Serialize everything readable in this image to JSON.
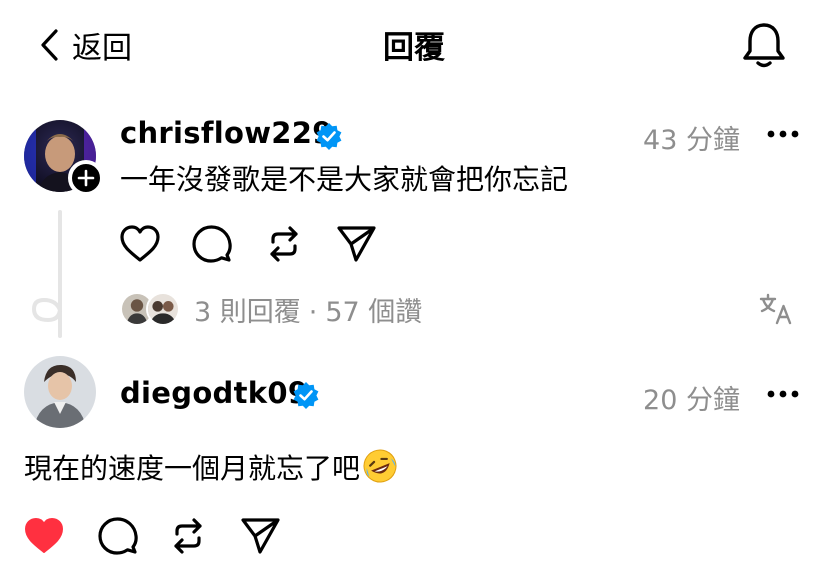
{
  "header": {
    "back_label": "返回",
    "title": "回覆"
  },
  "comments": [
    {
      "username": "chrisflow229",
      "verified": true,
      "time": "43 分鐘",
      "text": "一年沒發歌是不是大家就會把你忘記",
      "replies": "3 則回覆",
      "likes": "57 個讚"
    },
    {
      "username": "diegodtk09",
      "verified": true,
      "time": "20 分鐘",
      "text": "現在的速度一個月就忘了吧",
      "emoji": "rolling-on-floor-laughing",
      "liked": true
    }
  ],
  "colors": {
    "verified_blue": "#0095f6",
    "like_red": "#ff3040",
    "muted_gray": "#8e8e8e"
  }
}
